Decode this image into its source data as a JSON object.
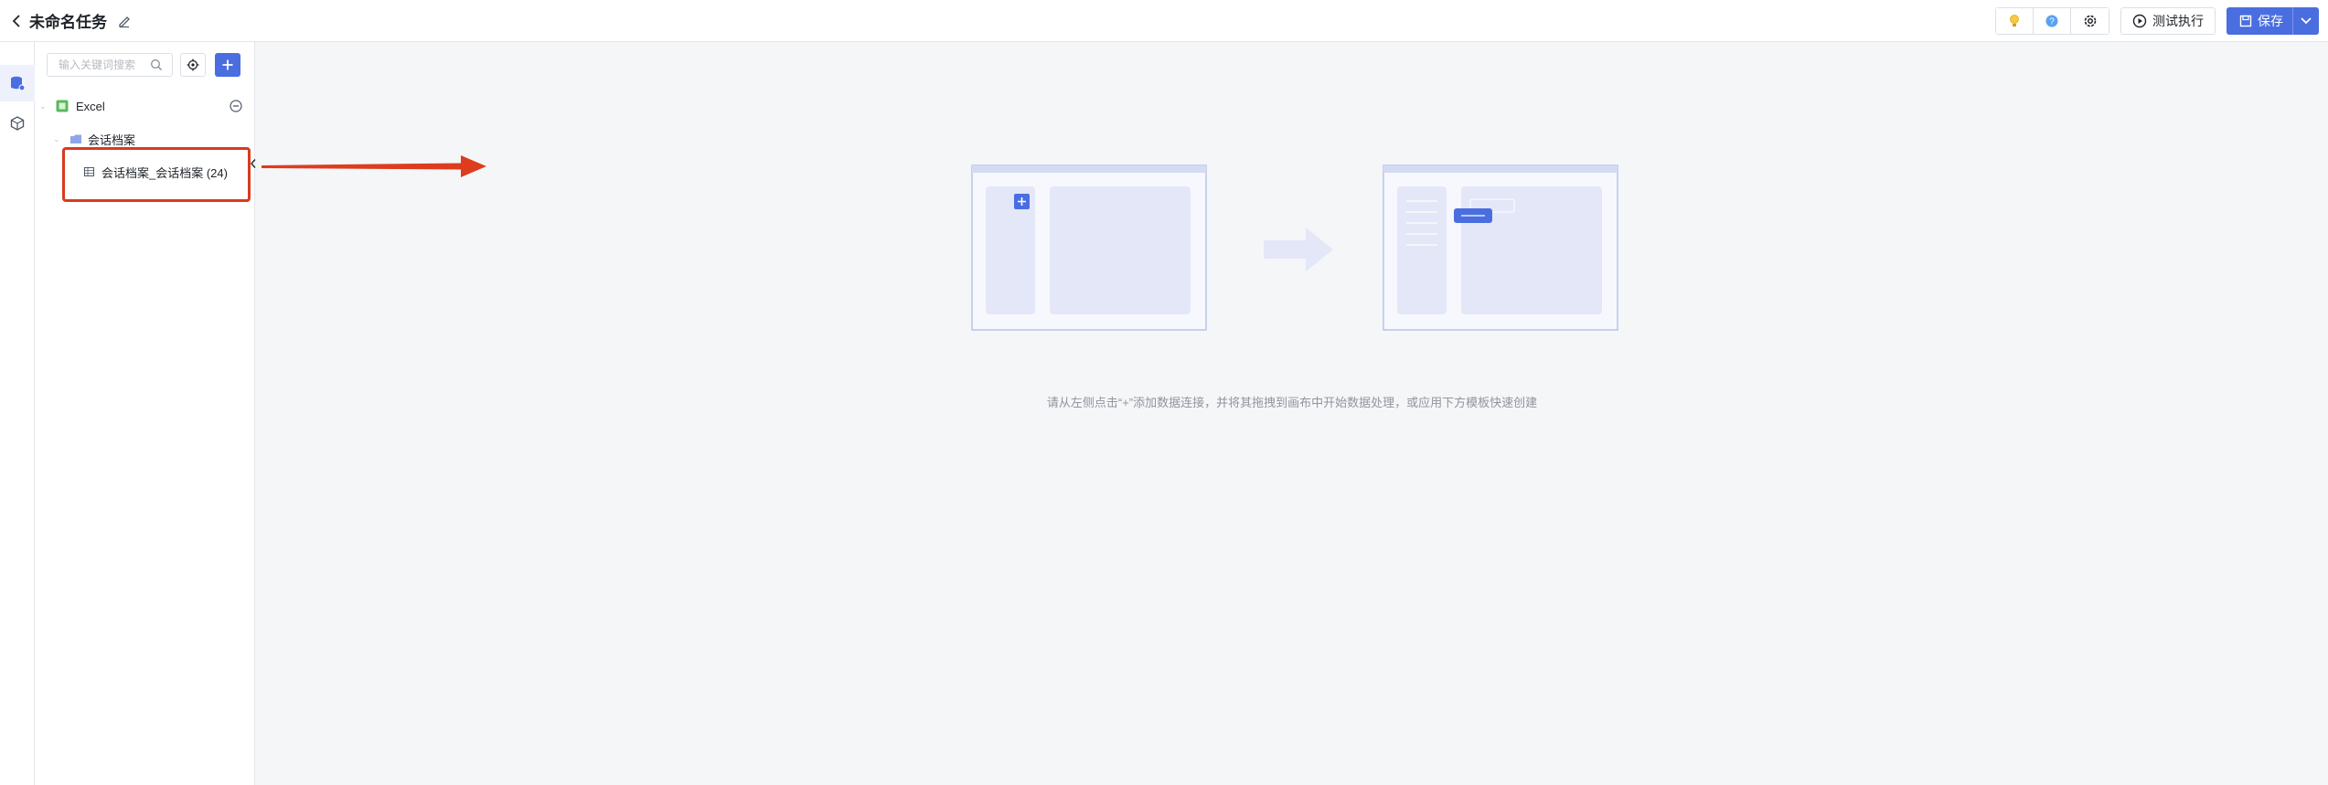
{
  "header": {
    "title": "未命名任务",
    "test_run_label": "测试执行",
    "save_label": "保存"
  },
  "sidebar": {
    "search_placeholder": "输入关键词搜索",
    "tree": {
      "root_label": "Excel",
      "folder_label": "会话档案",
      "table_label": "会话档案_会话档案 (24)"
    }
  },
  "canvas": {
    "hint": "请从左侧点击“+”添加数据连接，并将其拖拽到画布中开始数据处理，或应用下方模板快速创建"
  },
  "icons": {
    "back": "chevron-left-icon",
    "edit": "pencil-icon",
    "tip": "lightbulb-icon",
    "help": "help-icon",
    "settings": "gear-icon",
    "run": "play-circle-icon",
    "save": "save-icon",
    "dropdown": "chevron-down-icon",
    "rail_data": "database-icon",
    "rail_model": "cube-icon",
    "search": "search-icon",
    "locate": "target-icon",
    "add": "plus-icon"
  },
  "colors": {
    "accent": "#4a6ee0",
    "annotation": "#d93a1f",
    "excel_green": "#5cb85c"
  }
}
